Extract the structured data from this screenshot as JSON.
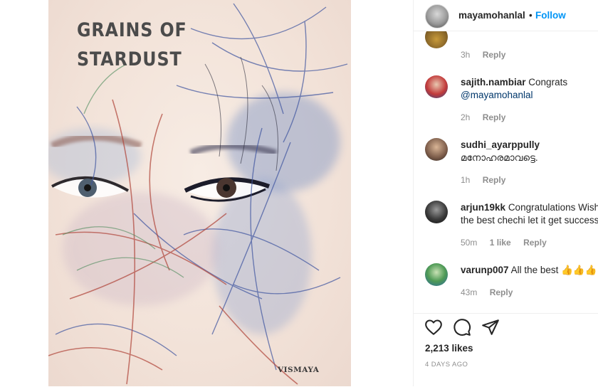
{
  "cover": {
    "title_line1": "GRAINS OF",
    "title_line2": "STARDUST",
    "author": "VISMAYA"
  },
  "header": {
    "username": "mayamohanlal",
    "separator": "•",
    "follow_label": "Follow"
  },
  "comments": [
    {
      "time": "3h",
      "reply_label": "Reply"
    },
    {
      "username": "sajith.nambiar",
      "text": "Congrats",
      "mention": "@mayamohanlal",
      "time": "2h",
      "reply_label": "Reply"
    },
    {
      "username": "sudhi_ayarppully",
      "text": "മനോഹരമാവട്ടെ.",
      "time": "1h",
      "reply_label": "Reply"
    },
    {
      "username": "arjun19kk",
      "text": "Congratulations Wish",
      "text_line2": "the best chechi let it get success",
      "time": "50m",
      "likes": "1 like",
      "reply_label": "Reply"
    },
    {
      "username": "varunp007",
      "text": "All the best",
      "emoji": "👍👍👍",
      "time": "43m",
      "reply_label": "Reply"
    }
  ],
  "actions": {
    "likes": "2,213 likes",
    "date": "4 DAYS AGO"
  },
  "icons": [
    "heart-icon",
    "comment-icon",
    "share-icon"
  ],
  "colors": {
    "link": "#0095f6",
    "mention": "#00376b",
    "meta": "#8e8e8e"
  }
}
